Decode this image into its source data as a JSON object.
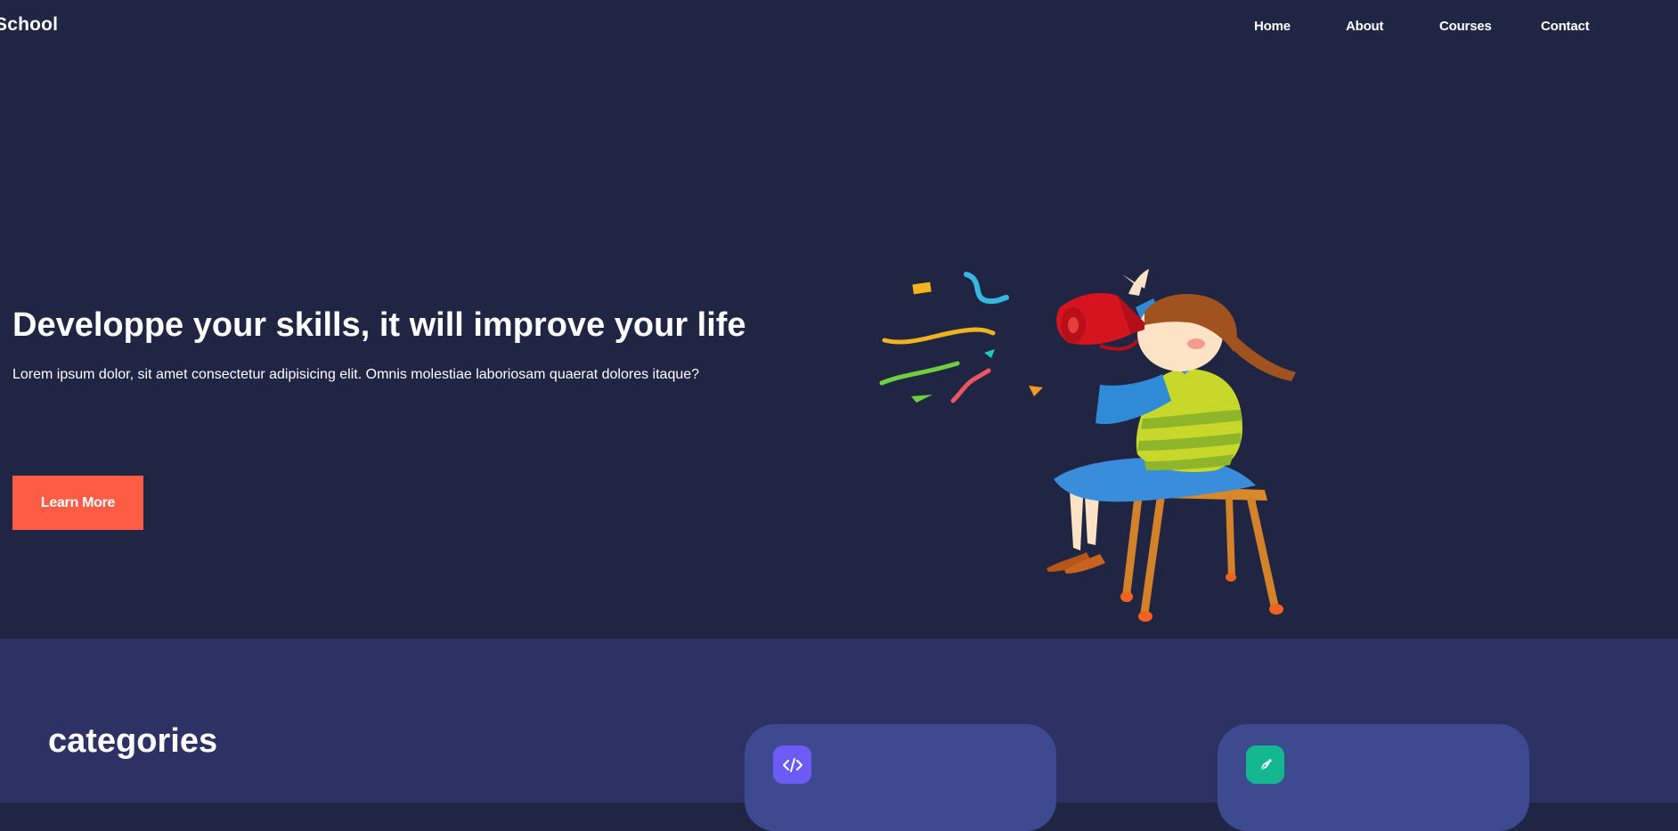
{
  "nav": {
    "logo": "School",
    "links": [
      "Home",
      "About",
      "Courses",
      "Contact"
    ]
  },
  "hero": {
    "title": "Developpe your skills, it will improve your life",
    "subtitle": "Lorem ipsum dolor, sit amet consectetur adipisicing elit. Omnis molestiae laboriosam quaerat dolores itaque?",
    "button_label": "Learn More"
  },
  "categories": {
    "title": "categories",
    "cards": [
      {
        "icon": "code-icon",
        "color": "#6c5cf5"
      },
      {
        "icon": "pen-nib-icon",
        "color": "#14b890"
      }
    ]
  },
  "colors": {
    "background": "#1f2542",
    "section_background": "#2d3164",
    "card_background": "#3e4a8f",
    "accent": "#ff5c45"
  }
}
